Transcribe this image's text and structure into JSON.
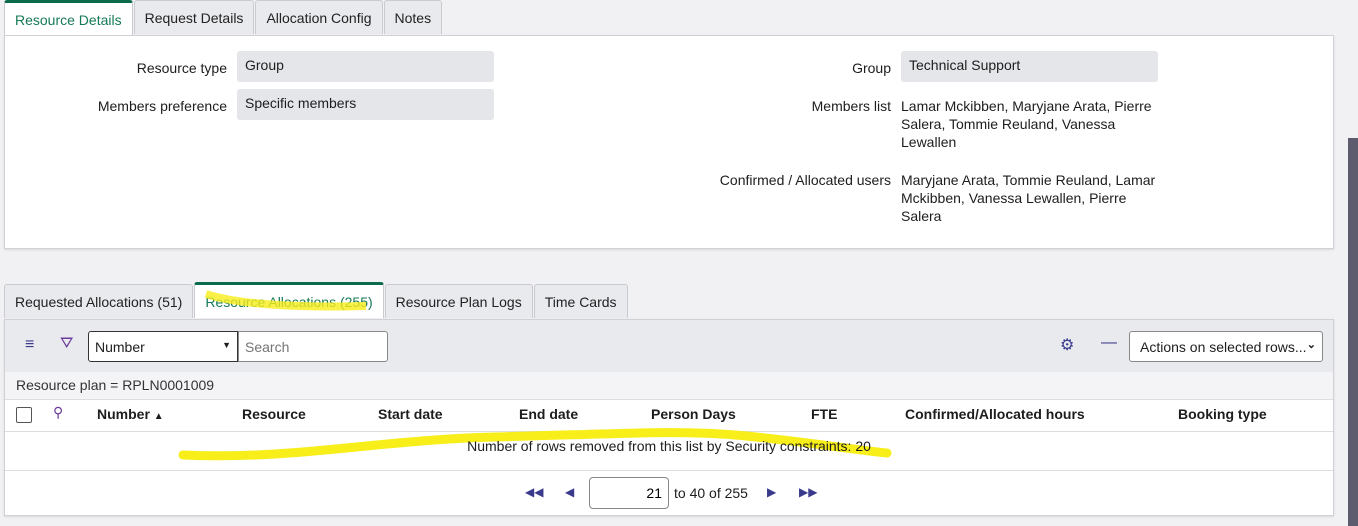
{
  "top_tabs": [
    "Resource Details",
    "Request Details",
    "Allocation Config",
    "Notes"
  ],
  "details": {
    "resource_type_label": "Resource type",
    "resource_type": "Group",
    "members_pref_label": "Members preference",
    "members_pref": "Specific members",
    "group_label": "Group",
    "group": "Technical Support",
    "members_list_label": "Members list",
    "members_list": "Lamar Mckibben, Maryjane Arata, Pierre Salera, Tommie Reuland, Vanessa Lewallen",
    "confirmed_label": "Confirmed / Allocated users",
    "confirmed": "Maryjane Arata, Tommie Reuland, Lamar Mckibben, Vanessa Lewallen, Pierre Salera"
  },
  "bottom_tabs": [
    "Requested Allocations (51)",
    "Resource Allocations (255)",
    "Resource Plan Logs",
    "Time Cards"
  ],
  "list": {
    "field_select": "Number",
    "search_placeholder": "Search",
    "actions": "Actions on selected rows...",
    "filter": "Resource plan = RPLN0001009",
    "columns": [
      "Number",
      "Resource",
      "Start date",
      "End date",
      "Person Days",
      "FTE",
      "Confirmed/Allocated hours",
      "Booking type"
    ],
    "message": "Number of rows removed from this list by Security constraints: 20",
    "page_input": "21",
    "page_range": "to 40 of 255"
  },
  "highlight_color": "#f7ee1a"
}
